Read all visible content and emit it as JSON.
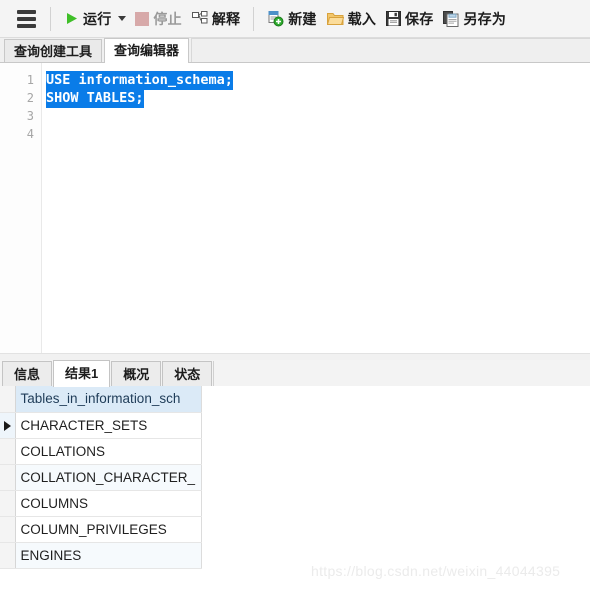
{
  "toolbar": {
    "menu_icon": "hamburger-menu-icon",
    "buttons": [
      {
        "id": "run",
        "label": "运行",
        "icon": "play-triangle-icon",
        "disabled": false,
        "has_dropdown": true
      },
      {
        "id": "stop",
        "label": "停止",
        "icon": "stop-square-icon",
        "disabled": true,
        "has_dropdown": false
      },
      {
        "id": "explain",
        "label": "解释",
        "icon": "explain-plan-icon",
        "disabled": false,
        "has_dropdown": false
      },
      {
        "id": "new",
        "label": "新建",
        "icon": "new-document-icon",
        "disabled": false,
        "has_dropdown": false
      },
      {
        "id": "load",
        "label": "载入",
        "icon": "open-folder-icon",
        "disabled": false,
        "has_dropdown": false
      },
      {
        "id": "save",
        "label": "保存",
        "icon": "floppy-disk-icon",
        "disabled": false,
        "has_dropdown": false
      },
      {
        "id": "save_as",
        "label": "另存为",
        "icon": "save-as-icon",
        "disabled": false,
        "has_dropdown": false
      }
    ]
  },
  "top_tabs": [
    {
      "label": "查询创建工具",
      "active": false
    },
    {
      "label": "查询编辑器",
      "active": true
    }
  ],
  "editor": {
    "line_numbers": [
      "1",
      "2",
      "3",
      "4"
    ],
    "lines": [
      {
        "text": "USE information_schema;",
        "selected": true
      },
      {
        "text": "SHOW TABLES;",
        "selected": true
      },
      {
        "text": "",
        "selected": false
      },
      {
        "text": "",
        "selected": false
      }
    ],
    "selection_color": "#0a7ce8"
  },
  "result_tabs": [
    {
      "label": "信息",
      "active": false
    },
    {
      "label": "结果1",
      "active": true
    },
    {
      "label": "概况",
      "active": false
    },
    {
      "label": "状态",
      "active": false
    }
  ],
  "grid": {
    "header_gutter": "",
    "columns": [
      "Tables_in_information_sch"
    ],
    "row_marker": "▶",
    "rows": [
      {
        "marker": true,
        "value": "CHARACTER_SETS"
      },
      {
        "marker": false,
        "value": "COLLATIONS"
      },
      {
        "marker": false,
        "value": "COLLATION_CHARACTER_"
      },
      {
        "marker": false,
        "value": "COLUMNS"
      },
      {
        "marker": false,
        "value": "COLUMN_PRIVILEGES"
      },
      {
        "marker": false,
        "value": "ENGINES"
      }
    ],
    "header_bg": "#dbeaf7"
  },
  "watermark": {
    "text": "https://blog.csdn.net/weixin_44044395"
  }
}
